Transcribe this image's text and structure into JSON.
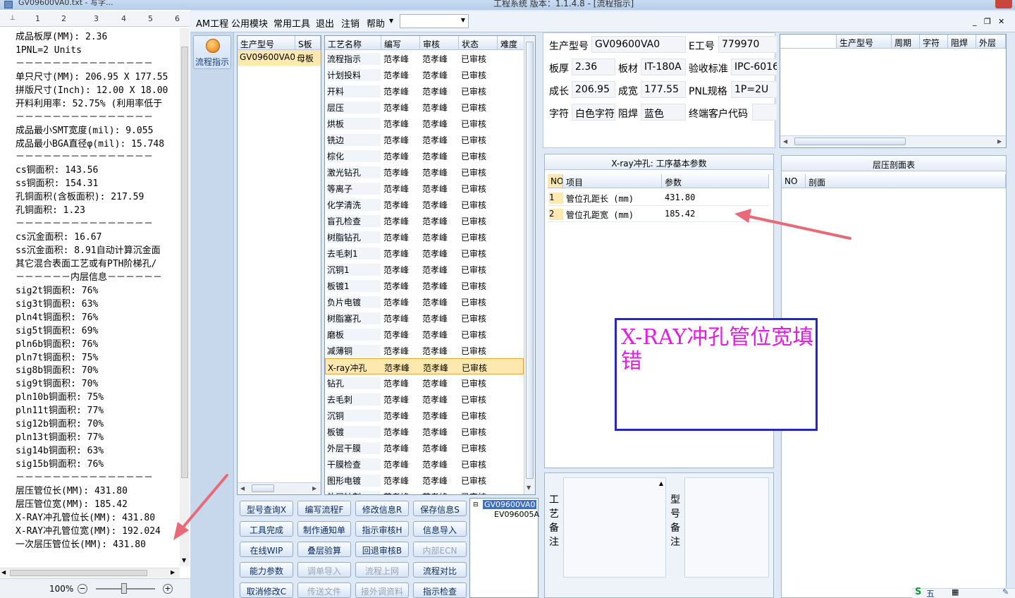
{
  "notepad": {
    "title": "GV09600VA0.txt - 写字...",
    "ruler_marks": [
      "1",
      "2",
      "3",
      "4",
      "5",
      "6"
    ],
    "lines": [
      "成品板厚(MM): 2.36",
      "1PNL=2 Units",
      "－－－－－－－－－－－－－－－",
      "单只尺寸(MM): 206.95 X 177.55",
      "拼版尺寸(Inch): 12.00 X 18.00",
      "开料利用率: 52.75% (利用率低于",
      "－－－－－－－－－－－－－－－",
      "成品最小SMT宽度(mil): 9.055",
      "成品最小BGA直径φ(mil): 15.748",
      "－－－－－－－－－－－－－－－",
      "cs铜面积: 143.56",
      "ss铜面积: 154.31",
      "孔铜面积(含板面积): 217.59",
      "孔铜面积: 1.23",
      "－－－－－－－－－－－－－－－",
      "cs沉金面积: 16.67",
      "ss沉金面积: 8.91自动计算沉金面",
      "其它混合表面工艺或有PTH阶梯孔/",
      "－－－－－－内层信息－－－－－－",
      "sig2t铜面积: 76%",
      "sig3t铜面积: 63%",
      "pln4t铜面积: 76%",
      "sig5t铜面积: 69%",
      "pln6b铜面积: 76%",
      "pln7t铜面积: 75%",
      "sig8b铜面积: 70%",
      "sig9t铜面积: 70%",
      "pln10b铜面积: 75%",
      "pln11t铜面积: 77%",
      "sig12b铜面积: 70%",
      "pln13t铜面积: 77%",
      "sig14b铜面积: 63%",
      "sig15b铜面积: 76%",
      "－－－－－－－－－－－－－－－",
      "层压管位长(MM): 431.80",
      "层压管位宽(MM): 185.42",
      "X-RAY冲孔管位长(MM): 431.80",
      "X-RAY冲孔管位宽(MM): 192.024",
      "一次层压管位长(MM): 431.80"
    ],
    "zoom": "100%",
    "zoom_minus": "−",
    "zoom_plus": "+"
  },
  "app": {
    "title": "工程系统   版本：1.1.4.8 - [流程指示]",
    "menu": [
      "AM工程",
      "公用模块",
      "常用工具",
      "退出",
      "注销",
      "帮助"
    ],
    "win_controls": [
      "_",
      "❐",
      "✕"
    ],
    "flow_button": "流程指示",
    "model_list": {
      "headers": [
        "生产型号",
        "S板"
      ],
      "rows": [
        [
          "GV09600VA0",
          "母板"
        ]
      ]
    },
    "process_list": {
      "headers": [
        "工艺名称",
        "编写",
        "审核",
        "状态",
        "难度"
      ],
      "selected_index": 19,
      "rows": [
        [
          "流程指示",
          "范孝峰",
          "范孝峰",
          "已审核"
        ],
        [
          "计划投料",
          "范孝峰",
          "范孝峰",
          "已审核"
        ],
        [
          "开料",
          "范孝峰",
          "范孝峰",
          "已审核"
        ],
        [
          "层压",
          "范孝峰",
          "范孝峰",
          "已审核"
        ],
        [
          "烘板",
          "范孝峰",
          "范孝峰",
          "已审核"
        ],
        [
          "铣边",
          "范孝峰",
          "范孝峰",
          "已审核"
        ],
        [
          "棕化",
          "范孝峰",
          "范孝峰",
          "已审核"
        ],
        [
          "激光钻孔",
          "范孝峰",
          "范孝峰",
          "已审核"
        ],
        [
          "等离子",
          "范孝峰",
          "范孝峰",
          "已审核"
        ],
        [
          "化学清洗",
          "范孝峰",
          "范孝峰",
          "已审核"
        ],
        [
          "盲孔检查",
          "范孝峰",
          "范孝峰",
          "已审核"
        ],
        [
          "树脂钻孔",
          "范孝峰",
          "范孝峰",
          "已审核"
        ],
        [
          "去毛刺1",
          "范孝峰",
          "范孝峰",
          "已审核"
        ],
        [
          "沉铜1",
          "范孝峰",
          "范孝峰",
          "已审核"
        ],
        [
          "板镀1",
          "范孝峰",
          "范孝峰",
          "已审核"
        ],
        [
          "负片电镀",
          "范孝峰",
          "范孝峰",
          "已审核"
        ],
        [
          "树脂塞孔",
          "范孝峰",
          "范孝峰",
          "已审核"
        ],
        [
          "磨板",
          "范孝峰",
          "范孝峰",
          "已审核"
        ],
        [
          "减薄铜",
          "范孝峰",
          "范孝峰",
          "已审核"
        ],
        [
          "X-ray冲孔",
          "范孝峰",
          "范孝峰",
          "已审核"
        ],
        [
          "钻孔",
          "范孝峰",
          "范孝峰",
          "已审核"
        ],
        [
          "去毛刺",
          "范孝峰",
          "范孝峰",
          "已审核"
        ],
        [
          "沉铜",
          "范孝峰",
          "范孝峰",
          "已审核"
        ],
        [
          "板镀",
          "范孝峰",
          "范孝峰",
          "已审核"
        ],
        [
          "外层干膜",
          "范孝峰",
          "范孝峰",
          "已审核"
        ],
        [
          "干膜检查",
          "范孝峰",
          "范孝峰",
          "已审核"
        ],
        [
          "图形电镀",
          "范孝峰",
          "范孝峰",
          "已审核"
        ],
        [
          "外层蚀刻",
          "范孝峰",
          "范孝峰",
          "已审核"
        ]
      ]
    },
    "buttons": [
      [
        "型号查询X",
        "编写流程F",
        "修改信息R",
        "保存信息S"
      ],
      [
        "工具完成",
        "制作通知单",
        "指示审核H",
        "信息导入"
      ],
      [
        "在线WIP",
        "叠层验算",
        "回退审核B",
        "内部ECN"
      ],
      [
        "能力参数",
        "调单导入",
        "流程上网",
        "流程对比"
      ],
      [
        "取消修改C",
        "传送文件",
        "接外调资料",
        "指示检查"
      ]
    ],
    "disabled_buttons": [
      "内部ECN",
      "调单导入",
      "流程上网",
      "传送文件",
      "接外调资料"
    ],
    "tree": {
      "root": "GV09600VA0",
      "child": "EV096005A"
    },
    "info": {
      "model_label": "生产型号",
      "model": "GV09600VA0",
      "eno_label": "E工号",
      "eno": "779970",
      "thick_label": "板厚",
      "thick": "2.36",
      "material_label": "板材",
      "material": "IT-180A",
      "standard_label": "验收标准",
      "standard": "IPC-6016",
      "length_label": "成长",
      "length": "206.95",
      "width_label": "成宽",
      "width": "177.55",
      "pnl_label": "PNL规格",
      "pnl": "1P=2U",
      "char_label": "字符",
      "char": "白色字符",
      "mask_label": "阻焊",
      "mask": "蓝色",
      "customer_label": "终端客户代码",
      "customer": ""
    },
    "right_grid_headers": [
      "生产型号",
      "周期",
      "字符",
      "阻焊",
      "外层"
    ],
    "params": {
      "title": "X-ray冲孔: 工序基本参数",
      "headers": [
        "NO",
        "项目",
        "参数"
      ],
      "rows": [
        [
          "1",
          "管位孔距长 (mm)",
          "431.80"
        ],
        [
          "2",
          "管位孔距宽 (mm)",
          "185.42"
        ]
      ]
    },
    "stack": {
      "title": "层压剖面表",
      "headers": [
        "NO",
        "剖面"
      ]
    },
    "process_note_label": "工艺备注",
    "model_note_label": "型号备注",
    "annotation": "X-RAY冲孔管位宽填错",
    "colors": {
      "selected_row": "#fde9b0",
      "annotation_text": "#e020e0",
      "annotation_border": "#2626c8",
      "arrow": "#e86a78"
    }
  }
}
